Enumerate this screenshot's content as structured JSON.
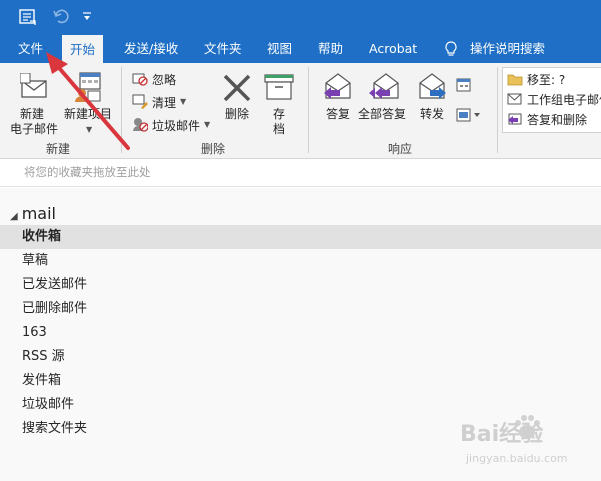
{
  "tabs": [
    {
      "label": "文件"
    },
    {
      "label": "开始"
    },
    {
      "label": "发送/接收"
    },
    {
      "label": "文件夹"
    },
    {
      "label": "视图"
    },
    {
      "label": "帮助"
    },
    {
      "label": "Acrobat"
    },
    {
      "label": "操作说明搜索"
    }
  ],
  "ribbon": {
    "new_group": {
      "new_email_line1": "新建",
      "new_email_line2": "电子邮件",
      "new_items": "新建项目",
      "group_label": "新建"
    },
    "delete_group": {
      "ignore": "忽略",
      "cleanup": "清理",
      "junk": "垃圾邮件",
      "delete": "删除",
      "archive_line1": "存",
      "archive_line2": "档",
      "group_label": "删除"
    },
    "respond_group": {
      "reply": "答复",
      "reply_all": "全部答复",
      "forward": "转发",
      "group_label": "响应"
    },
    "quick_steps": {
      "move_to": "移至: ?",
      "team_email": "工作组电子邮件",
      "reply_delete": "答复和删除"
    }
  },
  "favorites": {
    "placeholder": "将您的收藏夹拖放至此处"
  },
  "folder_pane": {
    "account": "mail",
    "folders": [
      {
        "label": "收件箱"
      },
      {
        "label": "草稿"
      },
      {
        "label": "已发送邮件"
      },
      {
        "label": "已删除邮件"
      },
      {
        "label": "163"
      },
      {
        "label": "RSS 源"
      },
      {
        "label": "发件箱"
      },
      {
        "label": "垃圾邮件"
      },
      {
        "label": "搜索文件夹"
      }
    ]
  },
  "watermark": {
    "brand": "Bai经验",
    "url": "jingyan.baidu.com"
  },
  "colors": {
    "accent": "#1e6fc5",
    "annotation_arrow": "#d9363e"
  }
}
